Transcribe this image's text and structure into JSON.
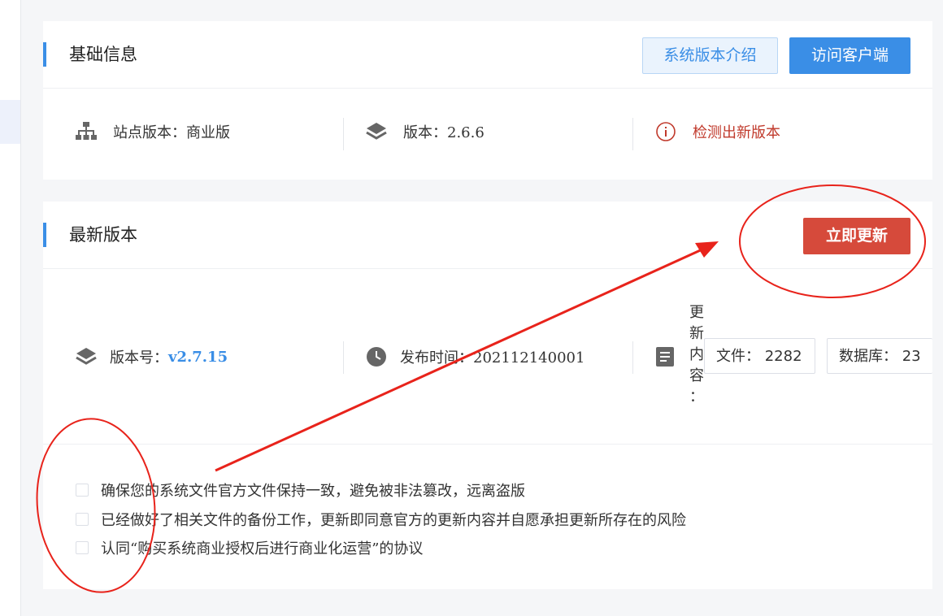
{
  "basic": {
    "title": "基础信息",
    "intro_button": "系统版本介绍",
    "client_button": "访问客户端",
    "site_version": "站点版本：商业版",
    "version": "版本：2.6.6",
    "new_version_alert": "检测出新版本"
  },
  "latest": {
    "title": "最新版本",
    "update_button": "立即更新",
    "version_label": "版本号：",
    "version_value": "v2.7.15",
    "release_label": "发布时间：202112140001",
    "content_label": [
      "更",
      "新",
      "内",
      "容",
      "："
    ],
    "files_tag": "文件： 2282",
    "db_tag": "数据库： 23"
  },
  "agreements": [
    "确保您的系统文件官方文件保持一致，避免被非法篡改，远离盗版",
    "已经做好了相关文件的备份工作，更新即同意官方的更新内容并自愿承担更新所存在的风险",
    "认同“购买系统商业授权后进行商业化运营”的协议"
  ],
  "colors": {
    "accent": "#3a8ee6",
    "danger": "#d64a3b",
    "annotation": "#e8231b"
  },
  "icons": {
    "site": "sitemap-icon",
    "version": "layers-icon",
    "alert": "info-circle-icon",
    "release": "clock-icon",
    "content": "document-icon"
  }
}
